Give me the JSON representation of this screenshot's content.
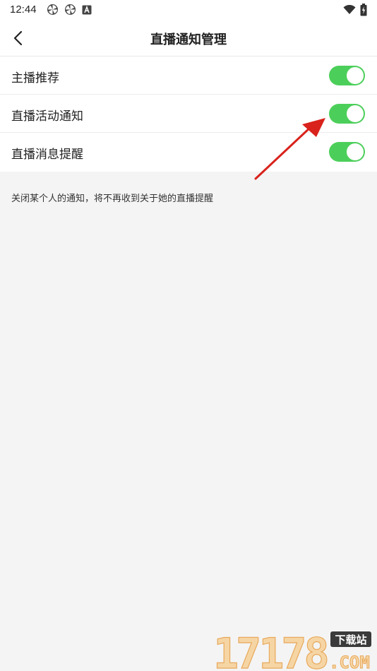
{
  "status_bar": {
    "time": "12:44",
    "left_icons": [
      "pinwheel-icon",
      "pinwheel-icon",
      "a-box-icon"
    ],
    "right_icons": [
      "wifi-icon",
      "battery-charging-icon"
    ]
  },
  "header": {
    "title": "直播通知管理",
    "back_icon": "chevron-left-icon"
  },
  "settings": {
    "items": [
      {
        "label": "主播推荐",
        "enabled": true
      },
      {
        "label": "直播活动通知",
        "enabled": true
      },
      {
        "label": "直播消息提醒",
        "enabled": true
      }
    ]
  },
  "hint": "关闭某个人的通知，将不再收到关于她的直播提醒",
  "annotation": {
    "type": "red-arrow",
    "color": "#d9221c",
    "points_to": "直播活动通知"
  },
  "watermark": {
    "site_number": "17178",
    "domain": ".COM",
    "badge": "下载站"
  },
  "colors": {
    "toggle_on": "#4ccf5a",
    "background": "#f4f4f4",
    "surface": "#ffffff"
  }
}
